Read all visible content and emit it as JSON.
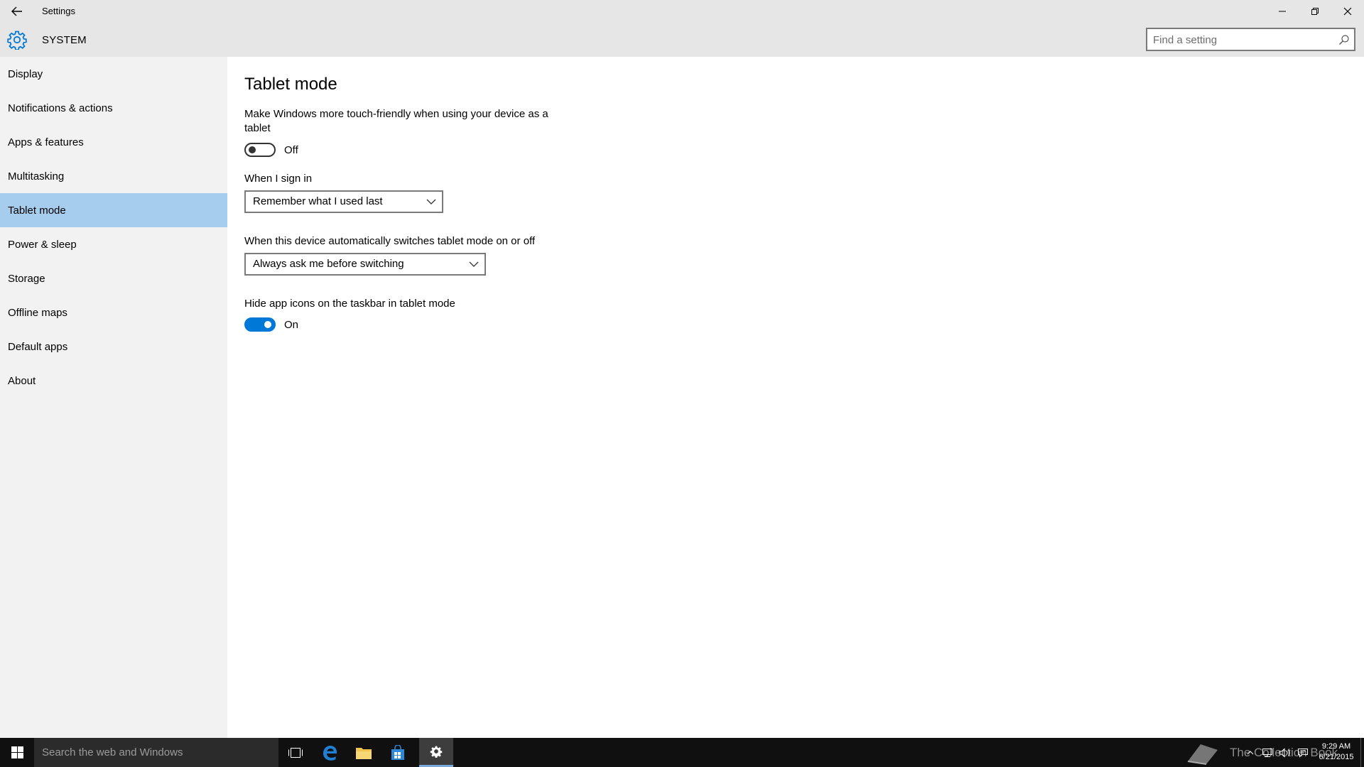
{
  "window": {
    "title": "Settings",
    "section_title": "SYSTEM"
  },
  "search": {
    "placeholder": "Find a setting"
  },
  "sidebar": {
    "items": [
      {
        "label": "Display"
      },
      {
        "label": "Notifications & actions"
      },
      {
        "label": "Apps & features"
      },
      {
        "label": "Multitasking"
      },
      {
        "label": "Tablet mode",
        "selected": true
      },
      {
        "label": "Power & sleep"
      },
      {
        "label": "Storage"
      },
      {
        "label": "Offline maps"
      },
      {
        "label": "Default apps"
      },
      {
        "label": "About"
      }
    ]
  },
  "main": {
    "title": "Tablet mode",
    "touch_friendly": {
      "description": "Make Windows more touch-friendly when using your device as a tablet",
      "state": "Off"
    },
    "sign_in": {
      "label": "When I sign in",
      "selected": "Remember what I used last"
    },
    "auto_switch": {
      "label": "When this device automatically switches tablet mode on or off",
      "selected": "Always ask me before switching"
    },
    "hide_icons": {
      "description": "Hide app icons on the taskbar in tablet mode",
      "state": "On"
    }
  },
  "taskbar": {
    "search_text": "Search the web and Windows",
    "watermark": "The Collection Book",
    "time": "9:29 AM",
    "date": "6/21/2015"
  },
  "colors": {
    "accent": "#0078d7",
    "selected_nav": "#a6cdee",
    "chrome": "#e6e6e6",
    "sidebar": "#f2f2f2",
    "taskbar": "#101010"
  }
}
